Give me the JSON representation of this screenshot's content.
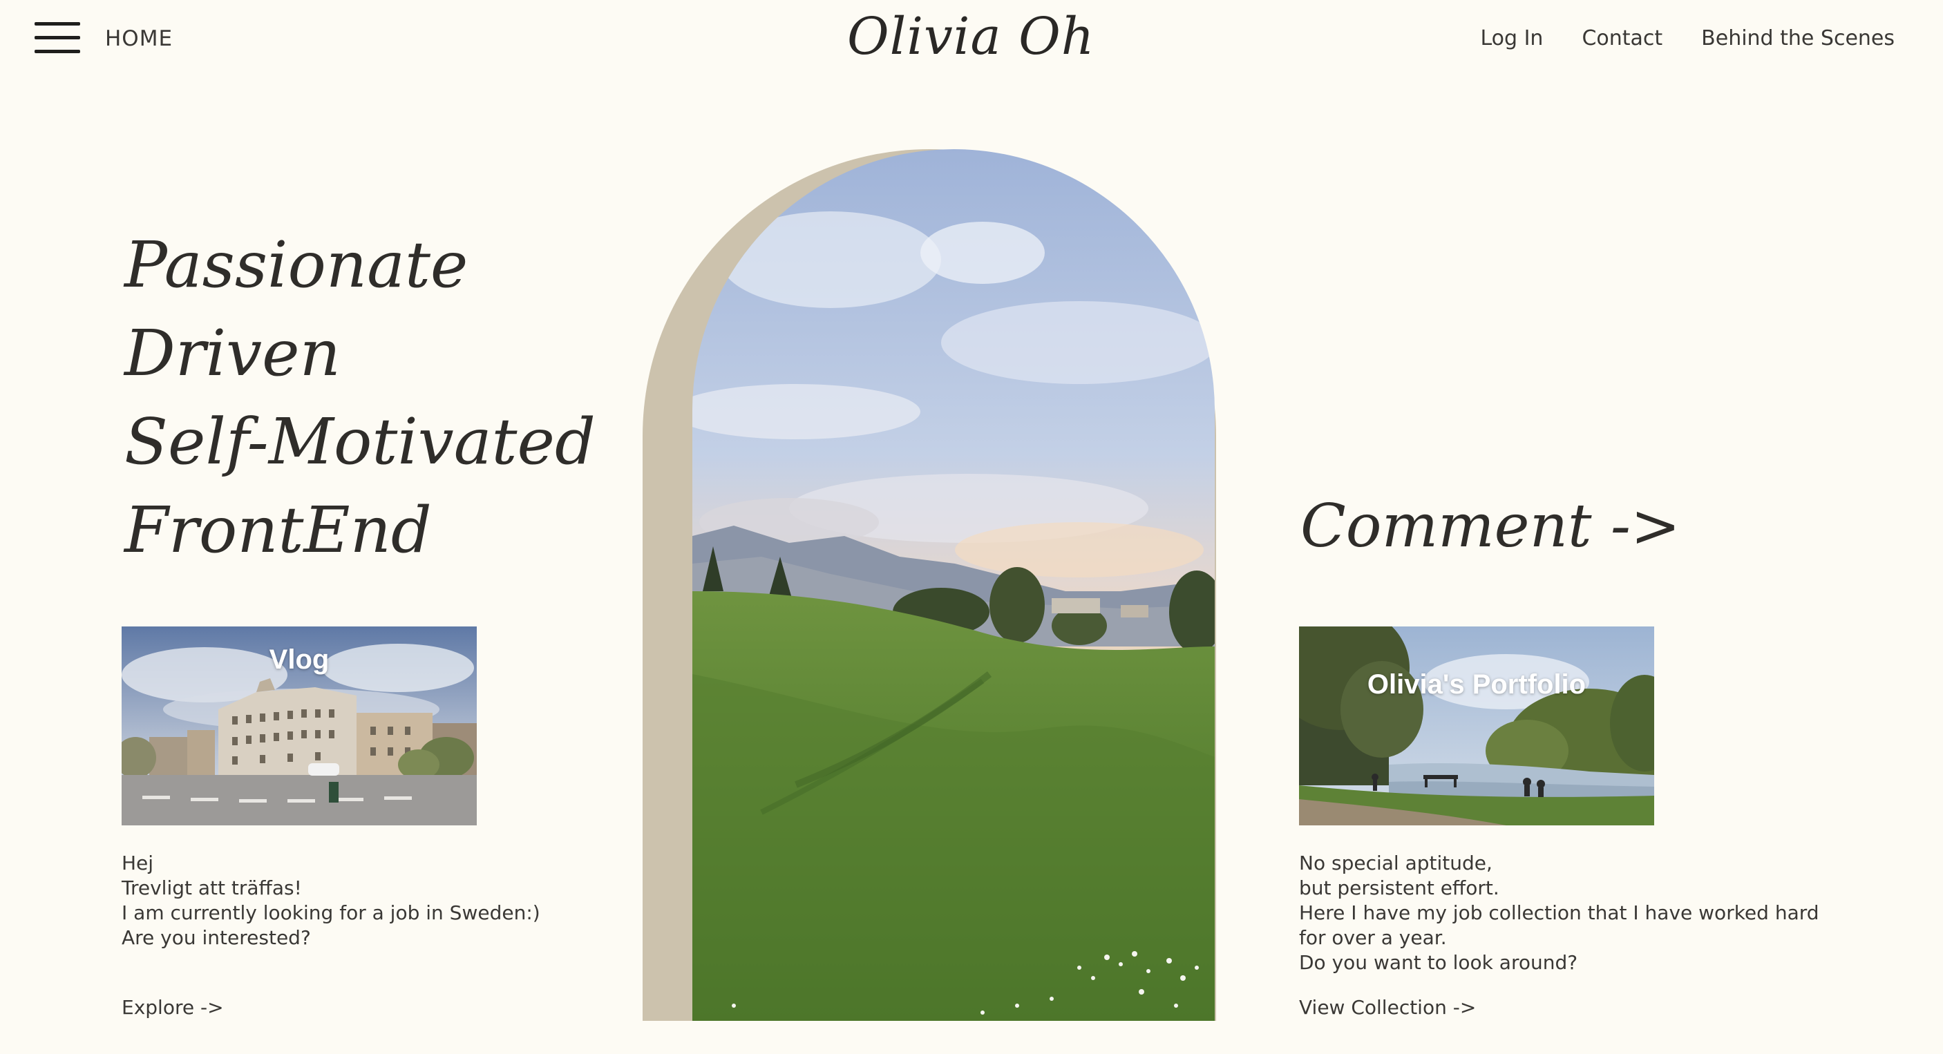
{
  "header": {
    "home_label": "HOME",
    "site_title": "Olivia Oh",
    "nav": [
      "Log In",
      "Contact",
      "Behind the Scenes"
    ]
  },
  "hero": {
    "taglines": [
      "Passionate",
      "Driven",
      "Self-Motivated",
      "FrontEnd"
    ],
    "comment_label": "Comment ->"
  },
  "vlog": {
    "card_title": "Vlog",
    "text": [
      "Hej",
      "Trevligt att träffas!",
      "I am currently looking for a job in Sweden:)",
      "Are you interested?"
    ],
    "cta": "Explore ->"
  },
  "portfolio": {
    "card_title": "Olivia's Portfolio",
    "text": [
      "No special aptitude,",
      "but persistent effort.",
      "Here I have my job collection that I have worked hard for over a year.",
      "Do you want to look around?"
    ],
    "cta": "View Collection ->"
  },
  "icons": {
    "menu": "hamburger-menu-icon"
  },
  "colors": {
    "background": "#fdfbf4",
    "arch_accent": "#ccc2ad",
    "text": "#3a3835"
  }
}
